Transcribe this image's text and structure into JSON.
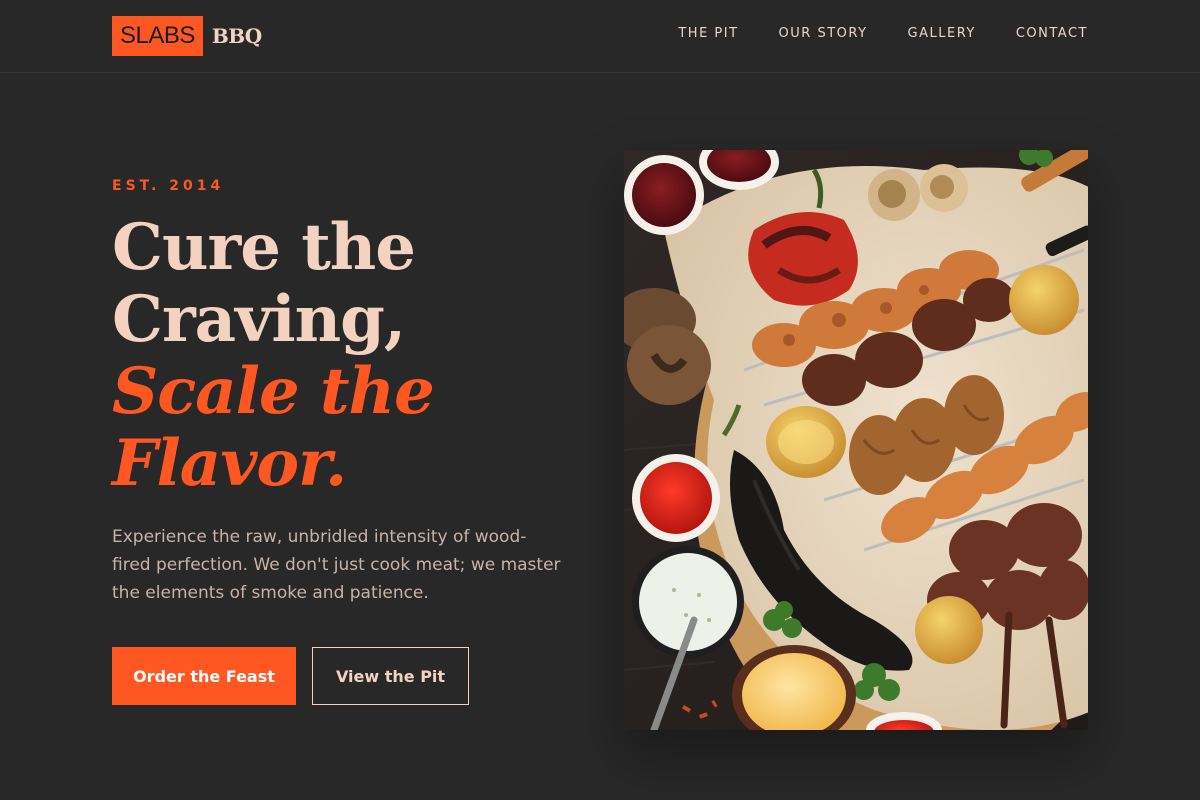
{
  "brand": {
    "logo_box": "SLABS",
    "logo_text": "BBQ",
    "accent_color": "#ff5722"
  },
  "nav": {
    "items": [
      {
        "label": "THE PIT"
      },
      {
        "label": "OUR STORY"
      },
      {
        "label": "GALLERY"
      },
      {
        "label": "CONTACT"
      }
    ]
  },
  "hero": {
    "eyebrow": "EST. 2014",
    "headline": {
      "line1": "Cure the",
      "line2": "Craving,",
      "line3": "Scale the",
      "line4": "Flavor."
    },
    "lede": "Experience the raw, unbridled intensity of wood-fired perfection. We don't just cook meat; we master the elements of smoke and patience.",
    "primary_cta": "Order the Feast",
    "secondary_cta": "View the Pit"
  },
  "image": {
    "subject": "grilled-meat-platter"
  }
}
